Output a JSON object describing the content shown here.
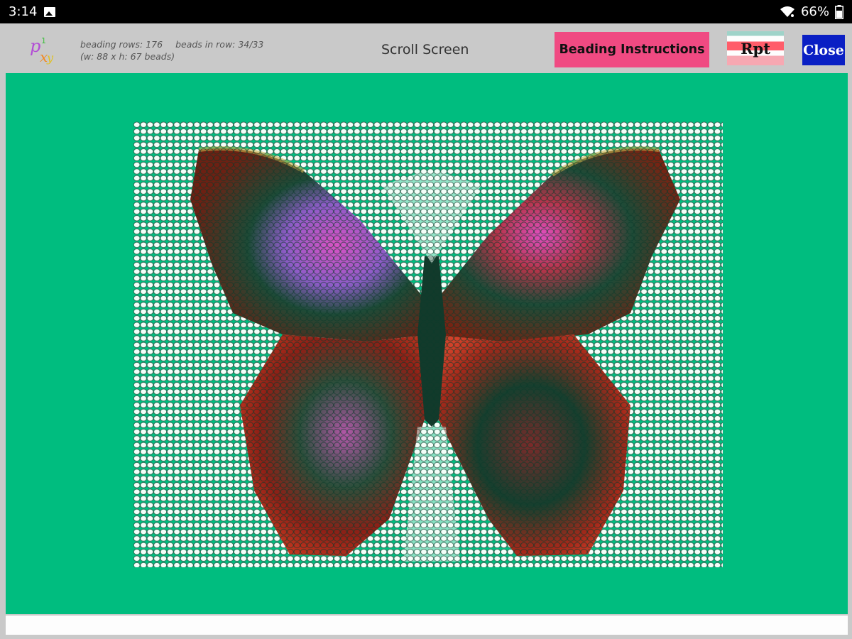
{
  "status_bar": {
    "time": "3:14",
    "battery_percent": "66%",
    "icons": [
      "gallery-icon",
      "wifi-icon",
      "battery-icon"
    ]
  },
  "toolbar": {
    "logo_icon": "pixel-xy-logo",
    "info": {
      "beading_rows": "beading rows: 176",
      "beads_in_row": "beads in row: 34/33",
      "dimensions": "(w: 88  x  h: 67 beads)"
    },
    "scroll_label": "Scroll Screen",
    "beading_instructions_label": "Beading Instructions",
    "rpt_label": "Rpt",
    "close_label": "Close"
  },
  "colors": {
    "canvas_background": "#00bd7f",
    "toolbar_background": "#c9c9c9",
    "beading_button": "#f04a82",
    "close_button": "#0a1fc4",
    "bead_background": "#e8f5ee"
  },
  "pattern": {
    "subject": "butterfly",
    "grid_columns": 88,
    "grid_rows": 67
  }
}
